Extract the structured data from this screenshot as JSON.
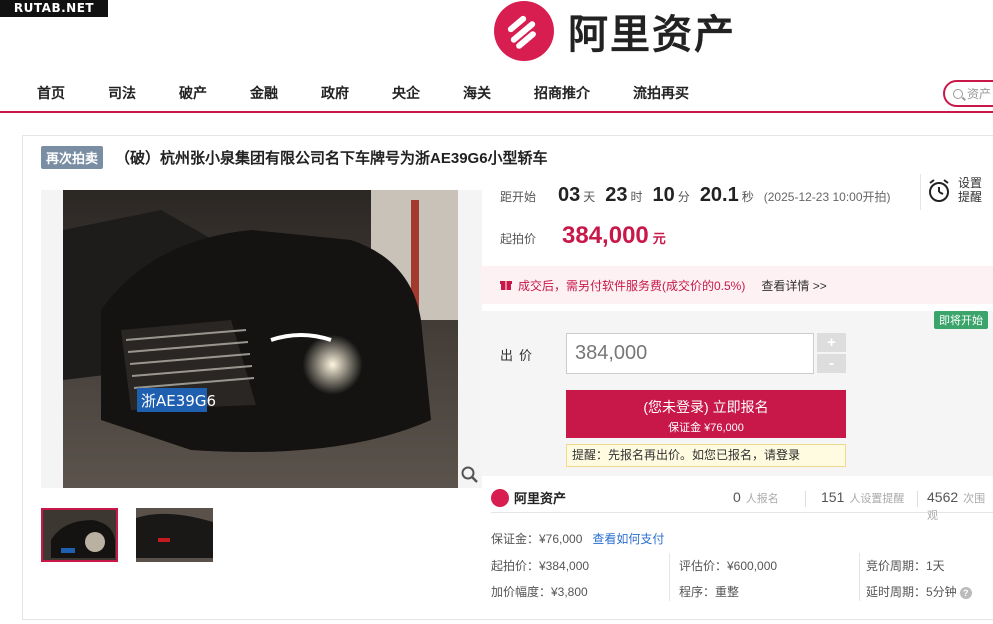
{
  "watermark": "RUTAB.NET",
  "brand": {
    "name": "阿里资产",
    "color": "#c8184a"
  },
  "nav": {
    "items": [
      "首页",
      "司法",
      "破产",
      "金融",
      "政府",
      "央企",
      "海关",
      "招商推介",
      "流拍再买"
    ],
    "search_placeholder": "资产"
  },
  "item": {
    "badge": "再次拍卖",
    "title": "（破）杭州张小泉集团有限公司名下车牌号为浙AE39G6小型轿车"
  },
  "countdown": {
    "label": "距开始",
    "days": "03",
    "days_unit": "天",
    "hours": "23",
    "hours_unit": "时",
    "minutes": "10",
    "minutes_unit": "分",
    "seconds": "20.1",
    "seconds_unit": "秒",
    "start_note": "(2025-12-23 10:00开拍)"
  },
  "reminder": {
    "label": "设置\n提醒",
    "icon": "alarm-clock-icon"
  },
  "start_price": {
    "label": "起拍价",
    "value": "384,000",
    "unit": "元"
  },
  "fee_notice": {
    "text": "成交后，需另付软件服务费(成交价的0.5%)",
    "link": "查看详情 >>"
  },
  "bid": {
    "status_badge": "即将开始",
    "label": "出价",
    "input_value": "384,000",
    "plus": "+",
    "minus": "-",
    "signup_line1": "(您未登录) 立即报名",
    "signup_line2": "保证金 ¥76,000",
    "tip_text": "提醒：先报名再出价。如您已报名，请",
    "tip_link": "登录"
  },
  "stats": {
    "logo_text": "阿里资产",
    "registered": "0",
    "registered_label": "人报名",
    "reminders": "151",
    "reminders_label": "人设置提醒",
    "views": "4562",
    "views_label": "次围观"
  },
  "details": {
    "deposit": "保证金：¥76,000",
    "deposit_link": "查看如何支付",
    "start_price": "起拍价：¥384,000",
    "increment": "加价幅度：¥3,800",
    "appraisal": "评估价：¥600,000",
    "procedure": "程序：重整",
    "bid_period": "竞价周期：1天",
    "extension": "延时周期：5分钟"
  }
}
